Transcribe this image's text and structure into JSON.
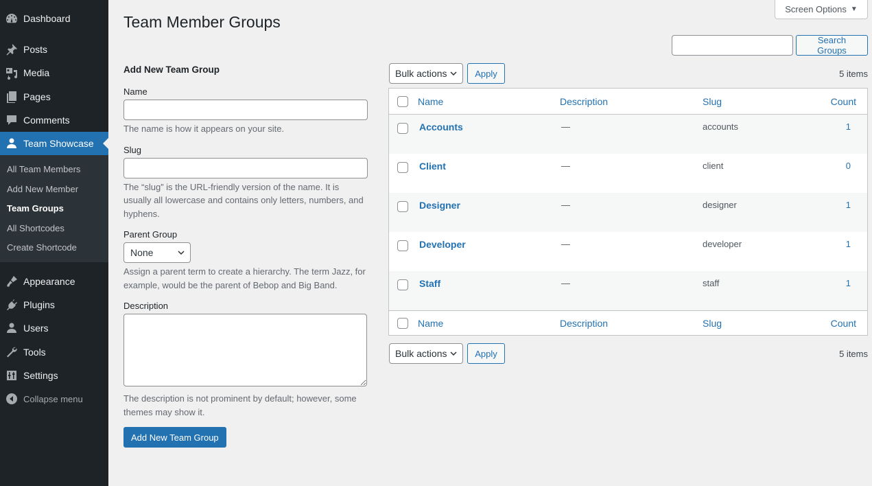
{
  "sidebar": {
    "items": [
      {
        "label": "Dashboard",
        "icon": "dashboard-icon"
      },
      {
        "label": "Posts",
        "icon": "pin-icon"
      },
      {
        "label": "Media",
        "icon": "media-icon"
      },
      {
        "label": "Pages",
        "icon": "pages-icon"
      },
      {
        "label": "Comments",
        "icon": "comment-icon"
      },
      {
        "label": "Team Showcase",
        "icon": "user-icon",
        "current": true
      },
      {
        "label": "Appearance",
        "icon": "paintbrush-icon"
      },
      {
        "label": "Plugins",
        "icon": "plugin-icon"
      },
      {
        "label": "Users",
        "icon": "users-icon"
      },
      {
        "label": "Tools",
        "icon": "wrench-icon"
      },
      {
        "label": "Settings",
        "icon": "settings-icon"
      },
      {
        "label": "Collapse menu",
        "icon": "collapse-icon"
      }
    ],
    "submenu": [
      {
        "label": "All Team Members"
      },
      {
        "label": "Add New Member"
      },
      {
        "label": "Team Groups",
        "current": true
      },
      {
        "label": "All Shortcodes"
      },
      {
        "label": "Create Shortcode"
      }
    ]
  },
  "header": {
    "title": "Team Member Groups",
    "screen_options": "Screen Options",
    "screen_options_arrow": "▼"
  },
  "search": {
    "value": "",
    "button": "Search Groups"
  },
  "form": {
    "heading": "Add New Team Group",
    "name_label": "Name",
    "name_value": "",
    "name_help": "The name is how it appears on your site.",
    "slug_label": "Slug",
    "slug_value": "",
    "slug_help": "The “slug” is the URL-friendly version of the name. It is usually all lowercase and contains only letters, numbers, and hyphens.",
    "parent_label": "Parent Group",
    "parent_value": "None",
    "parent_help": "Assign a parent term to create a hierarchy. The term Jazz, for example, would be the parent of Bebop and Big Band.",
    "description_label": "Description",
    "description_value": "",
    "description_help": "The description is not prominent by default; however, some themes may show it.",
    "submit": "Add New Team Group"
  },
  "tablenav": {
    "bulk_actions": "Bulk actions",
    "apply": "Apply",
    "items_count": "5 items"
  },
  "table": {
    "columns": {
      "name": "Name",
      "description": "Description",
      "slug": "Slug",
      "count": "Count"
    },
    "rows": [
      {
        "name": "Accounts",
        "description": "—",
        "slug": "accounts",
        "count": "1"
      },
      {
        "name": "Client",
        "description": "—",
        "slug": "client",
        "count": "0"
      },
      {
        "name": "Designer",
        "description": "—",
        "slug": "designer",
        "count": "1"
      },
      {
        "name": "Developer",
        "description": "—",
        "slug": "developer",
        "count": "1"
      },
      {
        "name": "Staff",
        "description": "—",
        "slug": "staff",
        "count": "1"
      }
    ]
  }
}
